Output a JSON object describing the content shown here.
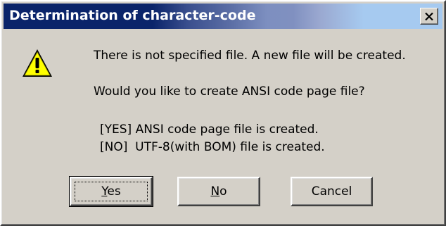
{
  "window": {
    "title": "Determination of character-code"
  },
  "message": {
    "line1": "There is not specified file. A new file will be created.",
    "line2": "Would you like to create ANSI code page file?",
    "line3": "[YES] ANSI code page file is created.",
    "line4": "[NO]  UTF-8(with BOM) file is created."
  },
  "buttons": {
    "yes": {
      "mnemonic": "Y",
      "rest": "es"
    },
    "no": {
      "mnemonic": "N",
      "rest": "o"
    },
    "cancel": "Cancel"
  },
  "icons": {
    "warning": "warning-icon",
    "close": "close-icon"
  },
  "colors": {
    "titlebar_start": "#0a246a",
    "titlebar_end": "#a6caf0",
    "face": "#d4d0c8",
    "warning_fill": "#ffff00"
  }
}
